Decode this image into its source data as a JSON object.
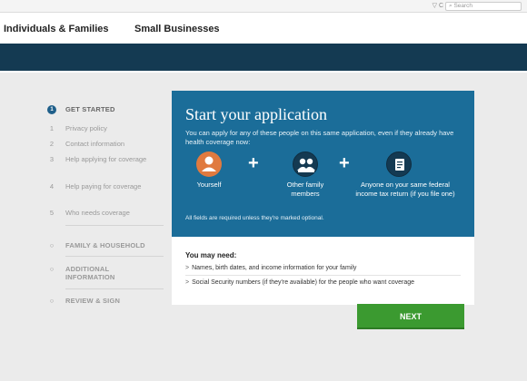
{
  "browser": {
    "search_placeholder": "Search",
    "controls": "▽ C"
  },
  "nav": {
    "individuals": "Individuals & Families",
    "small_business": "Small Businesses"
  },
  "steps": {
    "get_started": {
      "num": "1",
      "label": "GET STARTED"
    },
    "privacy": {
      "num": "1",
      "label": "Privacy policy"
    },
    "contact": {
      "num": "2",
      "label": "Contact information"
    },
    "help_applying": {
      "num": "3",
      "label": "Help applying for coverage"
    },
    "help_paying": {
      "num": "4",
      "label": "Help paying for coverage"
    },
    "who_needs": {
      "num": "5",
      "label": "Who needs coverage"
    },
    "family": {
      "num": "○",
      "label": "FAMILY & HOUSEHOLD"
    },
    "additional": {
      "num": "○",
      "label": "ADDITIONAL INFORMATION"
    },
    "review": {
      "num": "○",
      "label": "REVIEW & SIGN"
    }
  },
  "card": {
    "title": "Start your application",
    "subtitle": "You can apply for any of these people on this same application, even if they already have health coverage now:",
    "plus": "+",
    "people": {
      "yourself": "Yourself",
      "family": "Other family members",
      "tax": "Anyone on your same federal income tax return (if you file one)"
    },
    "note": "All fields are required unless they're marked optional.",
    "colors": {
      "card": "#1b6d99",
      "circle_orange": "#e07a3f",
      "circle_blue": "#143a52"
    }
  },
  "need": {
    "title": "You may need:",
    "items": [
      "Names, birth dates, and income information for your family",
      "Social Security numbers (if they're available) for the people who want coverage"
    ]
  },
  "next_label": "NEXT"
}
